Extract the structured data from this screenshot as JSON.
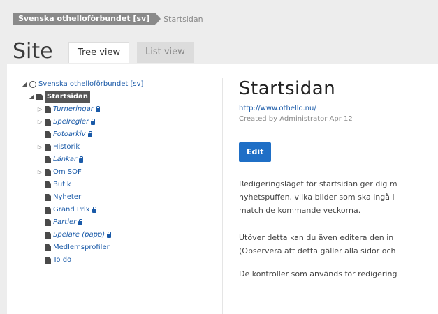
{
  "breadcrumb": {
    "active": "Svenska othelloförbundet [sv]",
    "next": "Startsidan"
  },
  "page": {
    "title": "Site"
  },
  "tabs": {
    "tree_view": "Tree view",
    "list_view": "List view"
  },
  "tree": {
    "root": "Svenska othelloförbundet [sv]",
    "selected": "Startsidan",
    "items": [
      {
        "label": "Turneringar",
        "locked": true,
        "expandable": true,
        "italic": true
      },
      {
        "label": "Spelregler",
        "locked": true,
        "expandable": true,
        "italic": true
      },
      {
        "label": "Fotoarkiv",
        "locked": true,
        "expandable": false,
        "italic": true
      },
      {
        "label": "Historik",
        "locked": false,
        "expandable": true,
        "italic": false
      },
      {
        "label": "Länkar",
        "locked": true,
        "expandable": false,
        "italic": true
      },
      {
        "label": "Om SOF",
        "locked": false,
        "expandable": true,
        "italic": false
      },
      {
        "label": "Butik",
        "locked": false,
        "expandable": false,
        "italic": false
      },
      {
        "label": "Nyheter",
        "locked": false,
        "expandable": false,
        "italic": false
      },
      {
        "label": "Grand Prix",
        "locked": true,
        "expandable": false,
        "italic": false
      },
      {
        "label": "Partier",
        "locked": true,
        "expandable": false,
        "italic": true
      },
      {
        "label": "Spelare (papp)",
        "locked": true,
        "expandable": false,
        "italic": true
      },
      {
        "label": "Medlemsprofiler",
        "locked": false,
        "expandable": false,
        "italic": false
      },
      {
        "label": "To do",
        "locked": false,
        "expandable": false,
        "italic": false
      }
    ]
  },
  "detail": {
    "title": "Startsidan",
    "url": "http://www.othello.nu/",
    "meta": "Created by Administrator Apr 12",
    "edit_label": "Edit",
    "para1_line1": "Redigeringsläget för startsidan ger dig m",
    "para1_line2": "nyhetspuffen, vilka bilder som ska ingå i",
    "para1_line3": "match de kommande veckorna.",
    "para2_line1": "Utöver detta kan du även editera den in",
    "para2_line2": "(Observera att detta gäller alla sidor och",
    "para3_line1": "De kontroller som används för redigering"
  }
}
